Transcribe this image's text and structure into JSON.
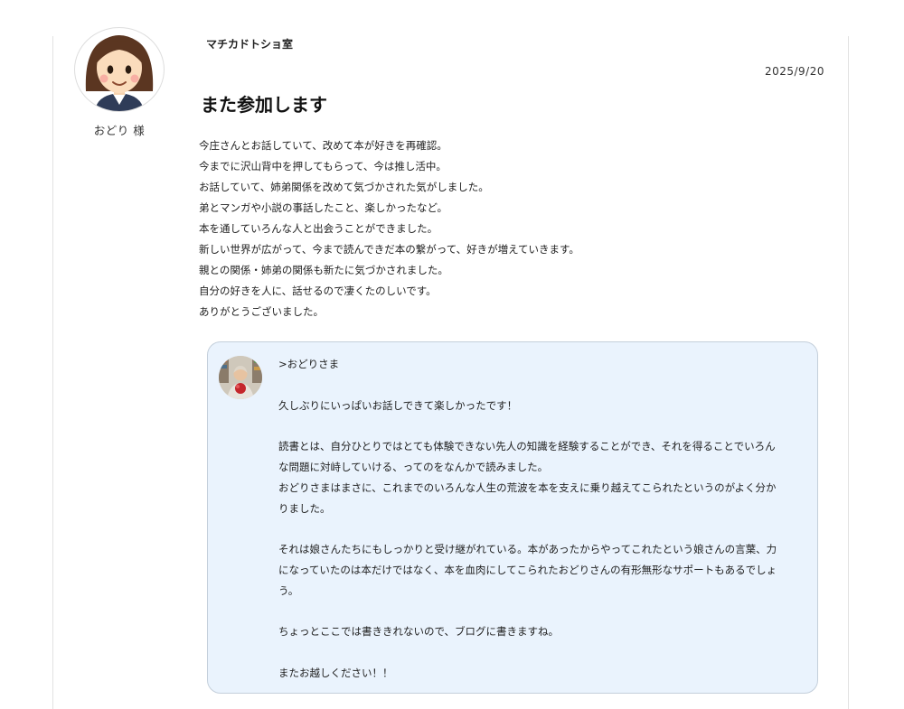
{
  "review": {
    "shop_name": "マチカドトショ室",
    "date": "2025/9/20",
    "reviewer_name": "おどり 様",
    "title": "また参加します",
    "body_lines": [
      "今庄さんとお話していて、改めて本が好きを再確認。",
      "今までに沢山背中を押してもらって、今は推し活中。",
      "お話していて、姉弟関係を改めて気づかされた気がしました。",
      "弟とマンガや小説の事話したこと、楽しかったなど。",
      "本を通していろんな人と出会うことができました。",
      "新しい世界が広がって、今まで読んできだ本の繋がって、好きが増えていきます。",
      "親との関係・姉弟の関係も新たに気づかされました。",
      "自分の好きを人に、話せるので凄くたのしいです。",
      "ありがとうございました。"
    ]
  },
  "reply": {
    "lines": [
      ">おどりさま",
      "",
      "久しぶりにいっぱいお話しできて楽しかったです！",
      "",
      "読書とは、自分ひとりではとても体験できない先人の知識を経験することができ、それを得ることでいろん",
      "な問題に対峙していける、ってのをなんかで読みました。",
      "おどりさまはまさに、これまでのいろんな人生の荒波を本を支えに乗り越えてこられたというのがよく分か",
      "りました。",
      "",
      "それは娘さんたちにもしっかりと受け継がれている。本があったからやってこれたという娘さんの言葉、力",
      "になっていたのは本だけではなく、本を血肉にしてこられたおどりさんの有形無形なサポートもあるでしょ",
      "う。",
      "",
      "ちょっとここでは書ききれないので、ブログに書きますね。",
      "",
      "またお越しください！！"
    ]
  },
  "icons": {
    "reviewer_avatar": "woman-avatar-icon",
    "reply_avatar": "staff-photo-avatar"
  }
}
